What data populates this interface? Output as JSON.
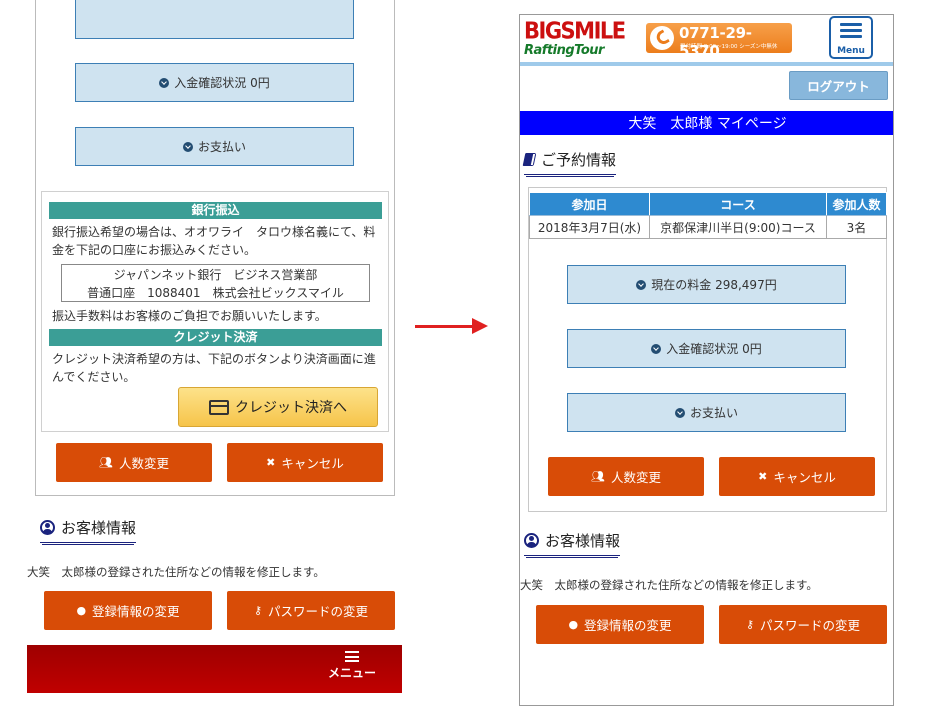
{
  "left": {
    "deposit_status_label": "入金確認状況 0円",
    "payment_label": "お支払い",
    "bank_section": {
      "heading": "銀行振込",
      "description": "銀行振込希望の場合は、オオワライ　タロウ様名義にて、料金を下記の口座にお振込みください。",
      "account_line1": "ジャパンネット銀行　ビジネス営業部",
      "account_line2": "普通口座　1088401　株式会社ビックスマイル",
      "fee_note": "振込手数料はお客様のご負担でお願いいたします。"
    },
    "credit_section": {
      "heading": "クレジット決済",
      "description": "クレジット決済希望の方は、下記のボタンより決済画面に進んでください。",
      "button_label": "クレジット決済へ"
    },
    "change_people_label": "人数変更",
    "cancel_label": "キャンセル",
    "customer_heading": "お客様情報",
    "customer_note": "大笑　太郎様の登録された住所などの情報を修正します。",
    "edit_info_label": "登録情報の変更",
    "password_label": "パスワードの変更",
    "menu_label": "メニュー"
  },
  "right": {
    "logo_top": "BIGSMILE",
    "logo_bottom": "RaftingTour",
    "phone_number": "0771-29-5370",
    "phone_hours": "受付時間 8:00～19:00 シーズン中無休",
    "menu_icon_label": "Menu",
    "logout_label": "ログアウト",
    "banner_title": "大笑　太郎様 マイページ",
    "reservation_heading": "ご予約情報",
    "table": {
      "headers": [
        "参加日",
        "コース",
        "参加人数"
      ],
      "rows": [
        [
          "2018年3月7日(水)",
          "京都保津川半日(9:00)コース",
          "3名"
        ]
      ]
    },
    "current_fee_label": "現在の料金 298,497円",
    "deposit_status_label": "入金確認状況 0円",
    "payment_label": "お支払い",
    "change_people_label": "人数変更",
    "cancel_label": "キャンセル",
    "customer_heading": "お客様情報",
    "customer_note": "大笑　太郎様の登録された住所などの情報を修正します。",
    "edit_info_label": "登録情報の変更",
    "password_label": "パスワードの変更"
  },
  "colors": {
    "orange_button": "#d84c07",
    "light_button": "#cfe3f0",
    "teal_heading": "#3b9e96",
    "table_header": "#2e8ad0",
    "banner": "#0000ff",
    "menu_bar": "#b00000",
    "arrow": "#e02020"
  }
}
